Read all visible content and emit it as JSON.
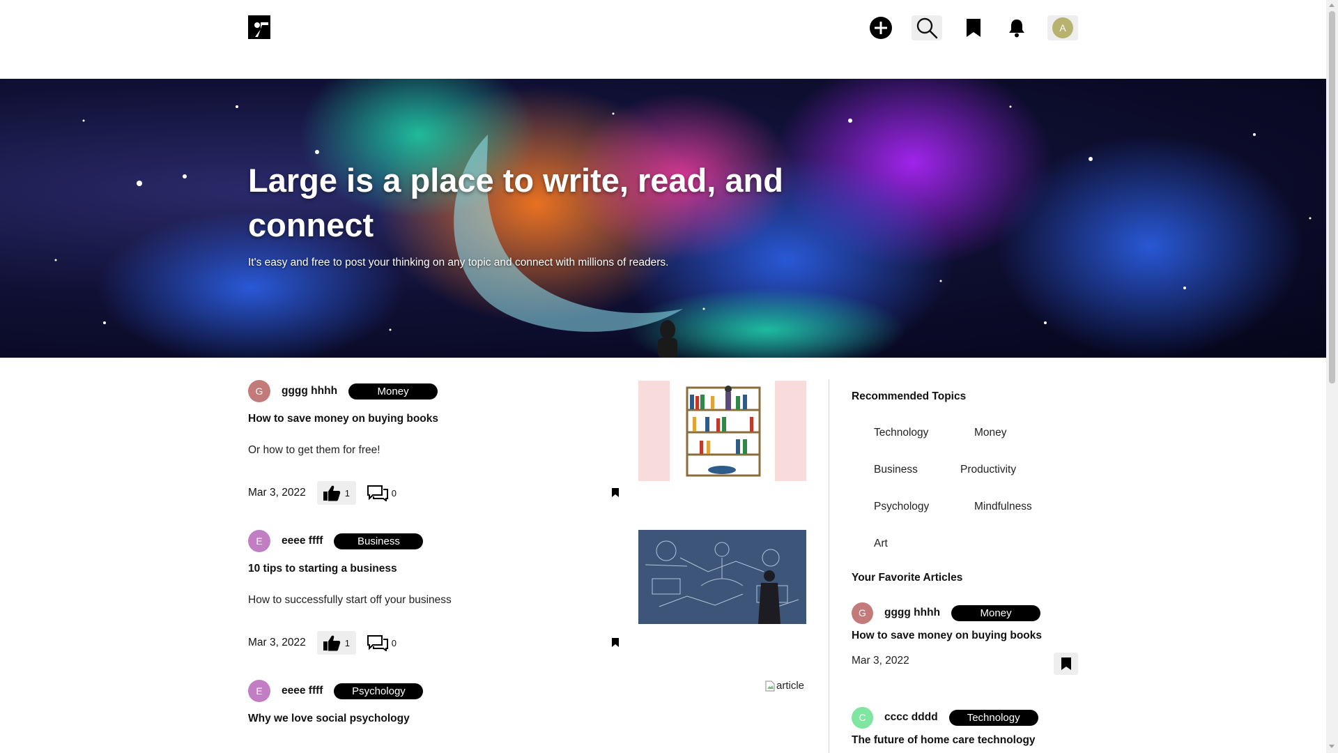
{
  "header": {
    "logo": "large-logo-icon",
    "actions": [
      {
        "name": "write-button",
        "icon": "plus-circle-icon"
      },
      {
        "name": "search-button",
        "icon": "search-icon"
      },
      {
        "name": "bookmarks-button",
        "icon": "bookmark-icon"
      },
      {
        "name": "notifications-button",
        "icon": "bell-icon"
      }
    ],
    "user_initial": "A"
  },
  "hero": {
    "title": "Large is a place to write, read, and connect",
    "subtitle": "It's easy and free to post your thinking on any topic and connect with millions of readers."
  },
  "articles": [
    {
      "initial": "G",
      "avatar_color": "#c27a7a",
      "author": "gggg hhhh",
      "tag": "Money",
      "title": "How to save money on buying books",
      "subtitle": "Or how to get them for free!",
      "date": "Mar 3, 2022",
      "likes": "1",
      "comments": "0",
      "image": "bookshelf-illustration"
    },
    {
      "initial": "E",
      "avatar_color": "#c17ec2",
      "author": "eeee ffff",
      "tag": "Business",
      "title": "10 tips to starting a business",
      "subtitle": "How to successfully start off your business",
      "date": "Mar 3, 2022",
      "likes": "1",
      "comments": "0",
      "image": "business-chalkboard-photo"
    },
    {
      "initial": "E",
      "avatar_color": "#c17ec2",
      "author": "eeee ffff",
      "tag": "Psychology",
      "title": "Why we love social psychology",
      "image_alt": "article"
    }
  ],
  "sidebar": {
    "topics_heading": "Recommended Topics",
    "topics": [
      "Technology",
      "Money",
      "Business",
      "Productivity",
      "Psychology",
      "Mindfulness",
      "Art"
    ],
    "favorites_heading": "Your Favorite Articles",
    "favorites": [
      {
        "initial": "G",
        "avatar_color": "#c27a7a",
        "author": "gggg hhhh",
        "tag": "Money",
        "title": "How to save money on buying books",
        "date": "Mar 3, 2022"
      },
      {
        "initial": "C",
        "avatar_color": "#7ee6a0",
        "author": "cccc dddd",
        "tag": "Technology",
        "title": "The future of home care technology"
      }
    ]
  },
  "colors": {
    "tag_bg": "#000000",
    "button_bg": "#eeeeee",
    "divider": "#d7d7d7"
  }
}
